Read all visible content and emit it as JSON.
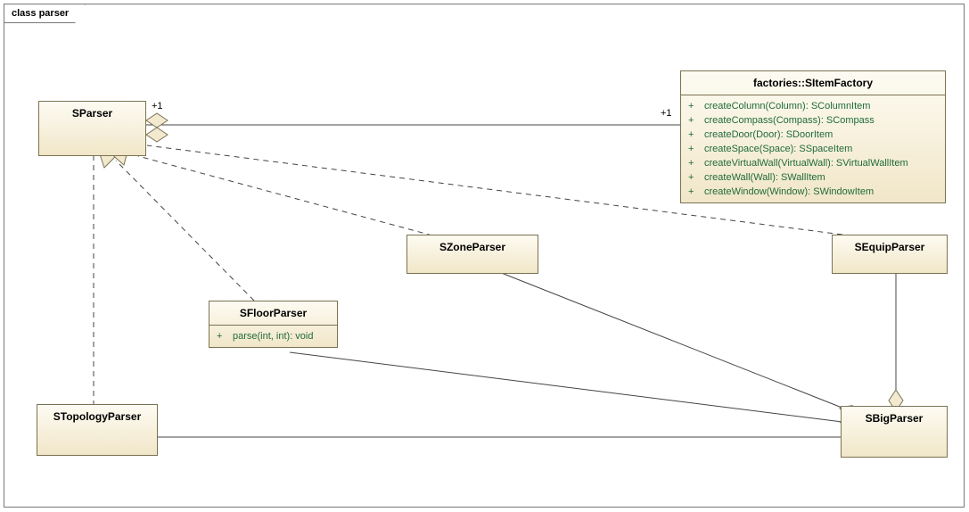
{
  "frame": {
    "label": "class parser"
  },
  "classes": {
    "sparser": {
      "name": "SParser"
    },
    "sitemfactory": {
      "name": "factories::SItemFactory",
      "methods": [
        "createColumn(Column): SColumnItem",
        "createCompass(Compass): SCompass",
        "createDoor(Door): SDoorItem",
        "createSpace(Space): SSpaceItem",
        "createVirtualWall(VirtualWall): SVirtualWallItem",
        "createWall(Wall): SWallItem",
        "createWindow(Window): SWindowItem"
      ]
    },
    "szoneparser": {
      "name": "SZoneParser"
    },
    "sequipparser": {
      "name": "SEquipParser"
    },
    "sfloorparser": {
      "name": "SFloorParser",
      "methods": [
        "parse(int, int): void"
      ]
    },
    "stopologyparser": {
      "name": "STopologyParser"
    },
    "sbigparser": {
      "name": "SBigParser"
    }
  },
  "multiplicities": {
    "sparser_side": "+1",
    "factory_side": "+1"
  }
}
